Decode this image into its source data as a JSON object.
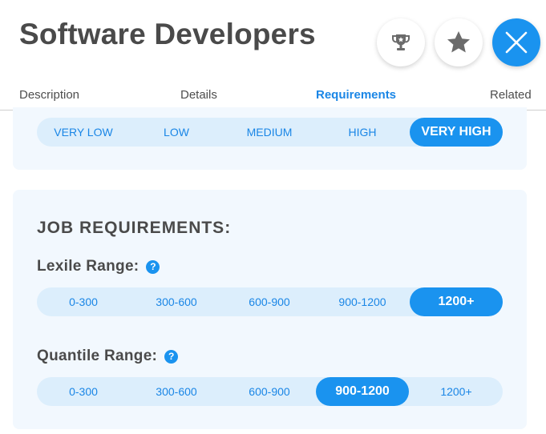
{
  "header": {
    "title": "Software Developers",
    "buttons": {
      "trophy": "trophy-icon",
      "star": "star-icon",
      "close": "close-icon"
    }
  },
  "tabs": [
    {
      "label": "Description",
      "active": false
    },
    {
      "label": "Details",
      "active": false
    },
    {
      "label": "Requirements",
      "active": true
    },
    {
      "label": "Related",
      "active": false
    }
  ],
  "level_scale": {
    "options": [
      "VERY LOW",
      "LOW",
      "MEDIUM",
      "HIGH",
      "VERY HIGH"
    ],
    "selected": "VERY HIGH"
  },
  "job_requirements": {
    "heading": "JOB REQUIREMENTS:",
    "lexile": {
      "label": "Lexile Range:",
      "help": "?",
      "options": [
        "0-300",
        "300-600",
        "600-900",
        "900-1200",
        "1200+"
      ],
      "selected": "1200+"
    },
    "quantile": {
      "label": "Quantile Range:",
      "help": "?",
      "options": [
        "0-300",
        "300-600",
        "600-900",
        "900-1200",
        "1200+"
      ],
      "selected": "900-1200"
    }
  },
  "colors": {
    "accent": "#1a93ef",
    "pill_bg": "#dceefc",
    "card_bg": "#f2f8fe",
    "title": "#4a4a4a"
  }
}
